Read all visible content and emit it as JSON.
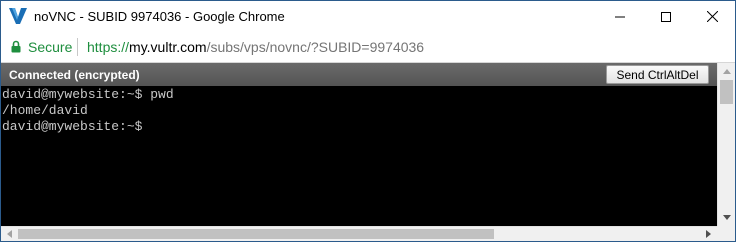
{
  "window": {
    "title": "noVNC - SUBID 9974036 - Google Chrome",
    "logo_icon": "vultr-v-logo-icon",
    "controls": {
      "minimize_icon": "minimize-icon",
      "maximize_icon": "maximize-icon",
      "close_icon": "close-icon"
    }
  },
  "addressbar": {
    "lock_icon": "lock-icon",
    "secure_label": "Secure",
    "url_scheme": "https://",
    "url_host": "my.vultr.com",
    "url_path": "/subs/vps/novnc/?SUBID=9974036"
  },
  "vnc": {
    "status": "Connected (encrypted)",
    "ctrlaltdel_label": "Send CtrlAltDel"
  },
  "terminal": {
    "lines": [
      "david@mywebsite:~$ pwd",
      "/home/david",
      "david@mywebsite:~$"
    ]
  },
  "colors": {
    "secure_green": "#1e8e3e",
    "status_bar": "#5e5e5e",
    "terminal_bg": "#000000",
    "terminal_fg": "#c8c8c8",
    "window_border": "#2b5b8c"
  }
}
